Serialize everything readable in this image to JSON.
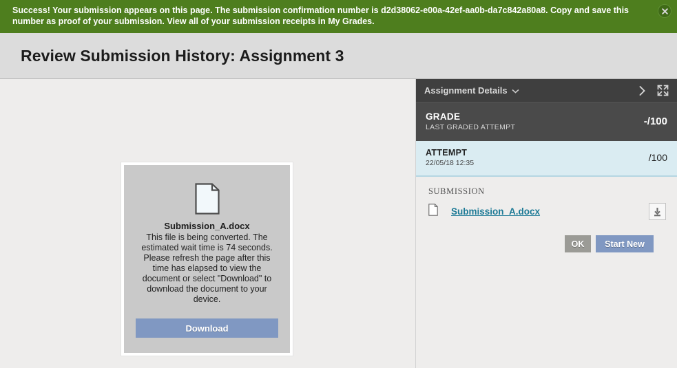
{
  "banner": {
    "sentence1": "Success! Your submission appears on this page. The submission confirmation number is d2d38062-e00a-42ef-aa0b-da7c842a80a8. Copy and save this number as proof of your submission.",
    "confirmation_number": "d2d38062-e00a-42ef-aa0b-da7c842a80a8",
    "sentence2": "View all of your submission receipts in My Grades.",
    "close_icon": "close-circle-icon",
    "background_color": "#4e7e1e"
  },
  "page": {
    "title": "Review Submission History: Assignment 3"
  },
  "preview": {
    "file_icon": "document-icon",
    "file_name": "Submission_A.docx",
    "message": "This file is being converted. The estimated wait time is 74 seconds. Please refresh the page after this time has elapsed to view the document or select \"Download\" to download the document to your device.",
    "download_label": "Download",
    "download_button_color": "#8098c2"
  },
  "panel": {
    "header_title": "Assignment Details",
    "header_chevron_icon": "chevron-down-icon",
    "collapse_icon": "chevron-right-icon",
    "expand_icon": "fullscreen-expand-icon",
    "grade": {
      "title": "GRADE",
      "subtitle": "LAST GRADED ATTEMPT",
      "score": "-/100"
    },
    "attempt": {
      "title": "ATTEMPT",
      "date": "22/05/18 12:35",
      "score": "/100"
    },
    "submission": {
      "label": "SUBMISSION",
      "file_icon": "document-icon",
      "file_name": "Submission_A.docx",
      "download_icon": "download-icon"
    },
    "actions": {
      "ok_label": "OK",
      "start_new_label": "Start New"
    }
  }
}
